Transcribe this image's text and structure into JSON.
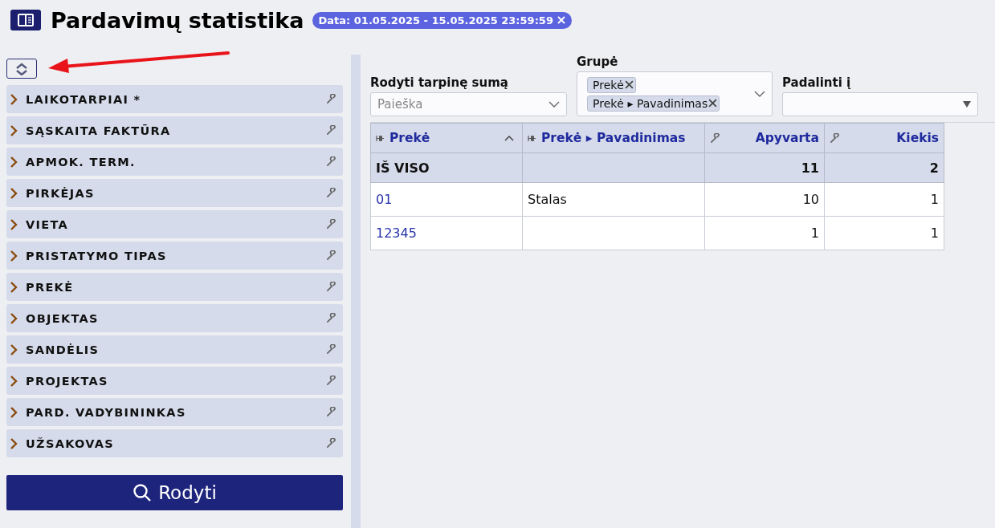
{
  "header": {
    "title": "Pardavimų statistika",
    "filter_badge": "Data: 01.05.2025 - 15.05.2025 23:59:59"
  },
  "sidebar": {
    "items": [
      {
        "label": "LAIKOTARPIAI *",
        "expanded": false
      },
      {
        "label": "SĄSKAITA FAKTŪRA",
        "expanded": false
      },
      {
        "label": "APMOK. TERM.",
        "expanded": false
      },
      {
        "label": "PIRKĖJAS",
        "expanded": false
      },
      {
        "label": "VIETA",
        "expanded": false
      },
      {
        "label": "PRISTATYMO TIPAS",
        "expanded": false
      },
      {
        "label": "PREKĖ",
        "expanded": false
      },
      {
        "label": "OBJEKTAS",
        "expanded": false
      },
      {
        "label": "SANDĖLIS",
        "expanded": false
      },
      {
        "label": "PROJEKTAS",
        "expanded": false
      },
      {
        "label": "PARD. VADYBININKAS",
        "expanded": false
      },
      {
        "label": "UŽSAKOVAS",
        "expanded": false
      }
    ],
    "show_button": "Rodyti"
  },
  "options": {
    "subtotal": {
      "label": "Rodyti tarpinę sumą",
      "placeholder": "Paieška"
    },
    "group": {
      "label": "Grupė",
      "tags": [
        "Prekė",
        "Prekė ▸ Pavadinimas"
      ]
    },
    "split": {
      "label": "Padalinti į"
    }
  },
  "table": {
    "columns": [
      {
        "label": "Prekė",
        "kind": "pin",
        "sorted": true
      },
      {
        "label": "Prekė ▸ Pavadinimas",
        "kind": "pin",
        "sorted": false
      },
      {
        "label": "Apyvarta",
        "kind": "wrench",
        "sorted": false
      },
      {
        "label": "Kiekis",
        "kind": "wrench",
        "sorted": false
      }
    ],
    "total": {
      "label": "IŠ VISO",
      "values": [
        "11",
        "2"
      ]
    },
    "rows": [
      [
        "01",
        "Stalas",
        "10",
        "1"
      ],
      [
        "12345",
        null,
        "1",
        "1"
      ]
    ]
  }
}
